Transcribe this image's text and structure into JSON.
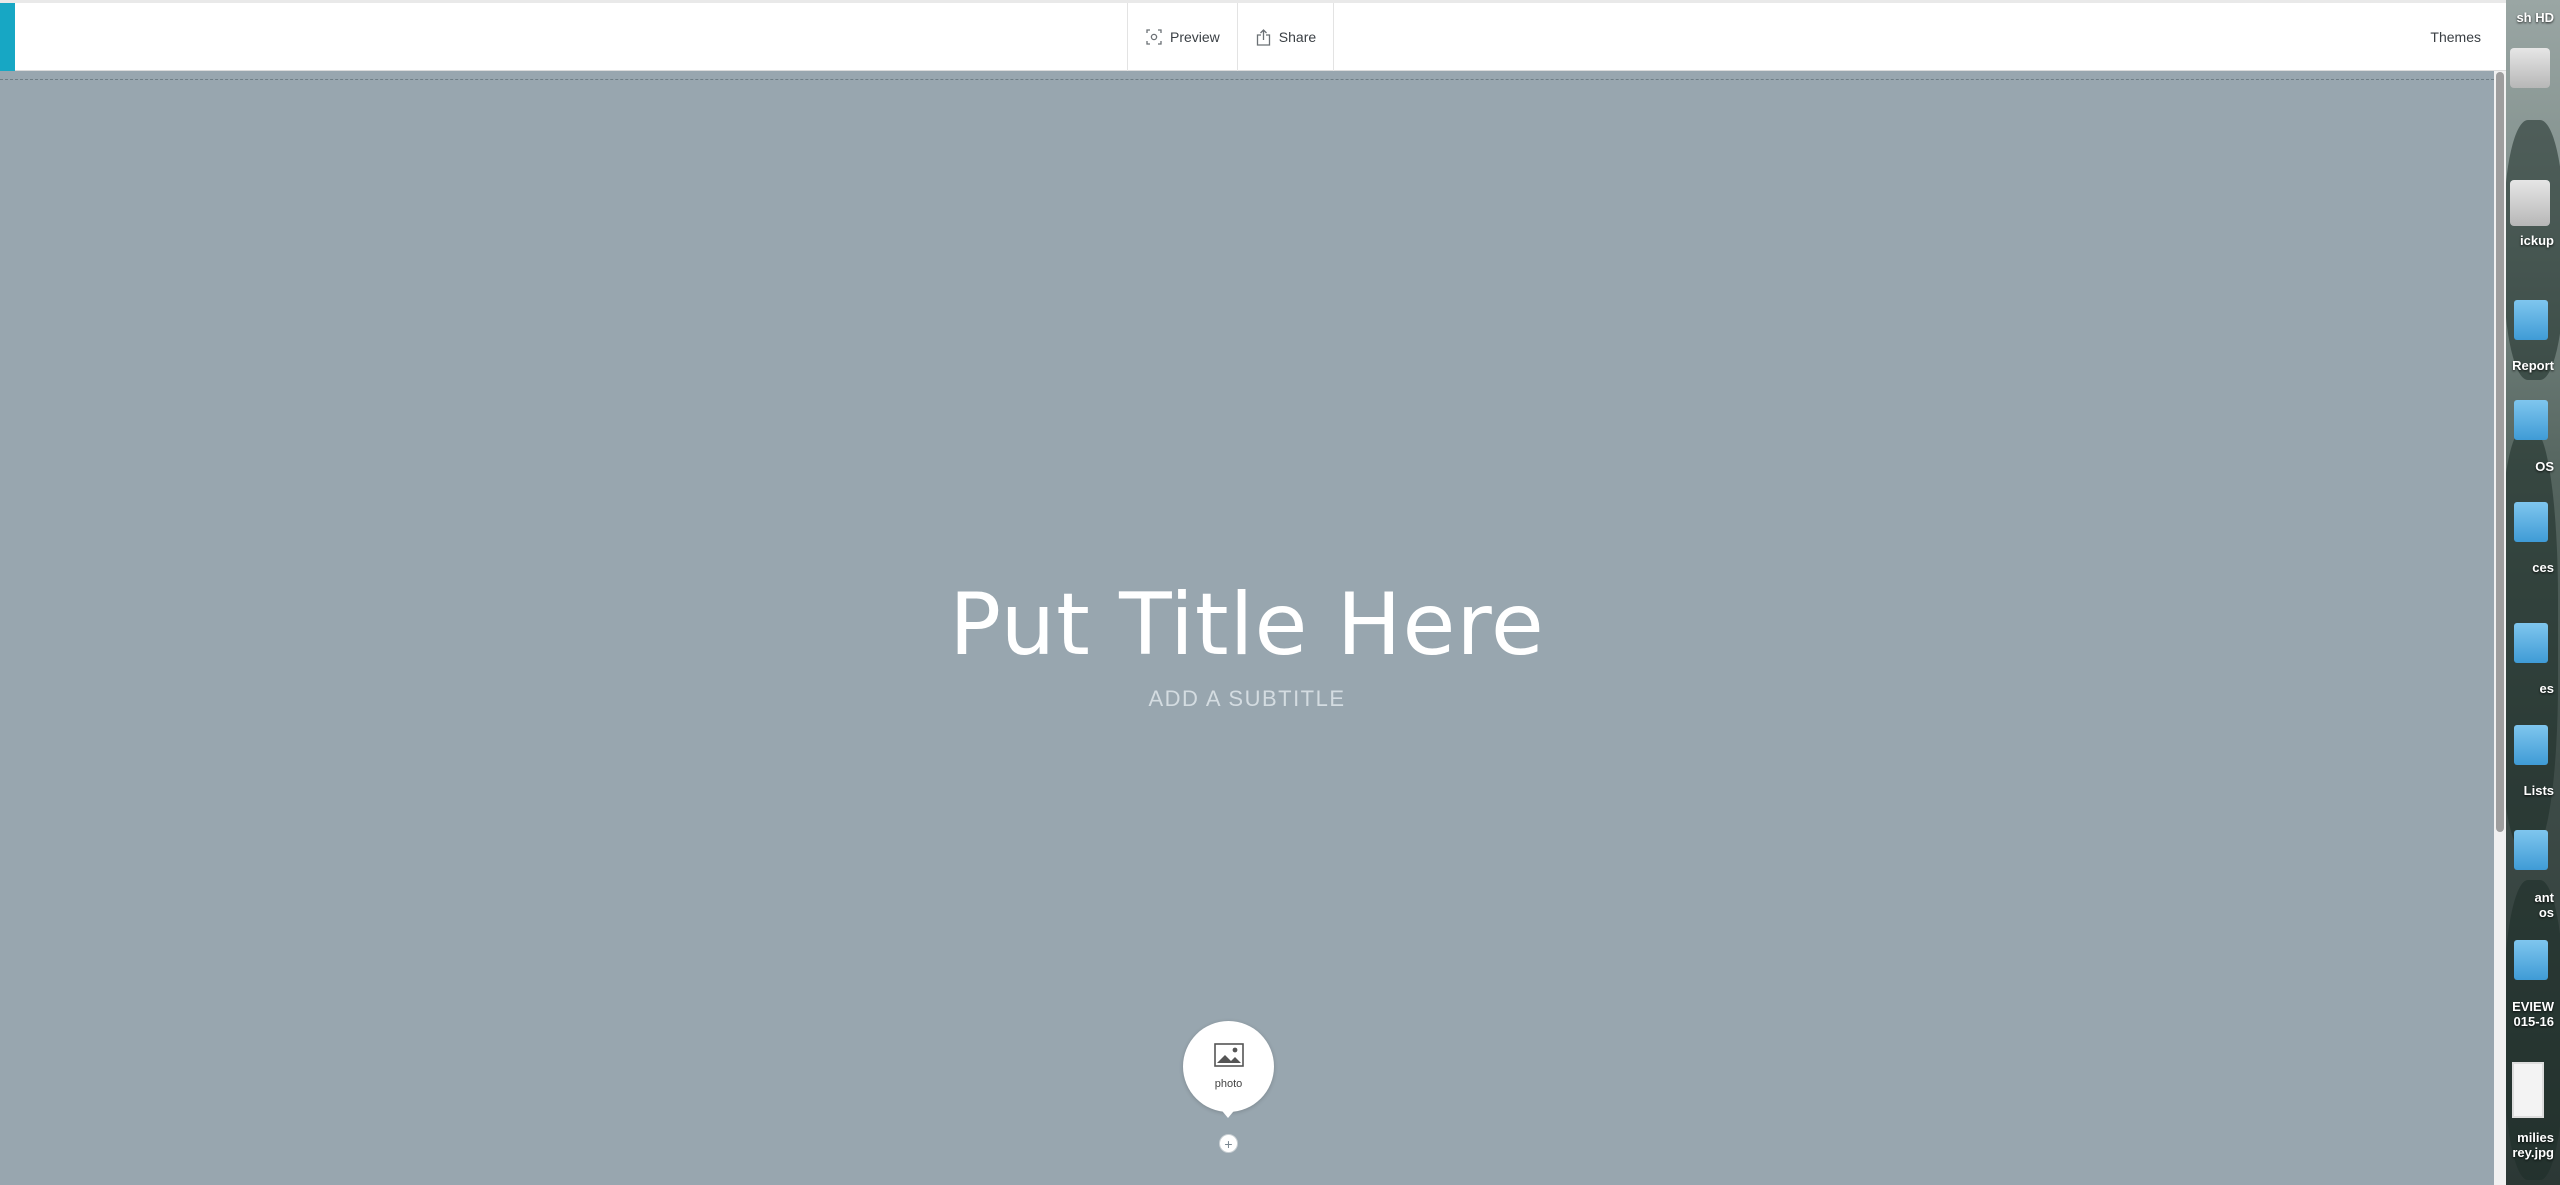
{
  "toolbar": {
    "preview_label": "Preview",
    "share_label": "Share",
    "themes_label": "Themes",
    "accent_color": "#17a7c4"
  },
  "canvas": {
    "title": "Put Title Here",
    "subtitle": "ADD A SUBTITLE",
    "background_color": "#98a6af",
    "photo_label": "photo",
    "add_symbol": "+"
  },
  "desktop": {
    "items": [
      {
        "label": "sh HD",
        "icon": "drive-icon"
      },
      {
        "label": "ickup",
        "icon": "drive-icon"
      },
      {
        "label": "Report",
        "icon": "folder-icon"
      },
      {
        "label": "OS",
        "icon": "folder-icon"
      },
      {
        "label": "ces",
        "icon": "folder-icon"
      },
      {
        "label": "es",
        "icon": "folder-icon"
      },
      {
        "label": "Lists",
        "icon": "folder-icon"
      },
      {
        "label": "ant\nos",
        "icon": "folder-icon"
      },
      {
        "label": "EVIEW\n015-16",
        "icon": "folder-icon"
      },
      {
        "label": "milies\nrey.jpg",
        "icon": "image-file-icon"
      }
    ]
  }
}
